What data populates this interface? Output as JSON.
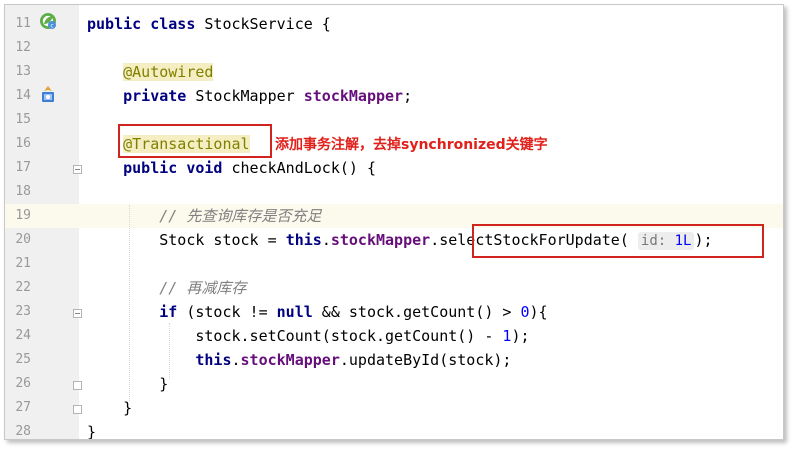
{
  "editor": {
    "lines": [
      {
        "num": "11",
        "tokens": [
          {
            "t": "kw",
            "v": "public class"
          },
          {
            "t": "plain",
            "v": " StockService {"
          }
        ]
      },
      {
        "num": "12",
        "tokens": []
      },
      {
        "num": "13",
        "tokens": [
          {
            "t": "plain",
            "v": "    "
          },
          {
            "t": "ann",
            "v": "@Autowired"
          }
        ]
      },
      {
        "num": "14",
        "tokens": [
          {
            "t": "plain",
            "v": "    "
          },
          {
            "t": "kw",
            "v": "private"
          },
          {
            "t": "plain",
            "v": " StockMapper "
          },
          {
            "t": "fld",
            "v": "stockMapper"
          },
          {
            "t": "plain",
            "v": ";"
          }
        ]
      },
      {
        "num": "15",
        "tokens": []
      },
      {
        "num": "16",
        "tokens": [
          {
            "t": "plain",
            "v": "    "
          },
          {
            "t": "ann",
            "v": "@Transactional"
          }
        ]
      },
      {
        "num": "17",
        "tokens": [
          {
            "t": "plain",
            "v": "    "
          },
          {
            "t": "kw",
            "v": "public void"
          },
          {
            "t": "plain",
            "v": " checkAndLock() {"
          }
        ]
      },
      {
        "num": "18",
        "tokens": []
      },
      {
        "num": "19",
        "tokens": [
          {
            "t": "plain",
            "v": "        "
          },
          {
            "t": "cmt",
            "v": "// 先查询库存是否充足"
          }
        ]
      },
      {
        "num": "20",
        "tokens": [
          {
            "t": "plain",
            "v": "        Stock stock = "
          },
          {
            "t": "kw",
            "v": "this"
          },
          {
            "t": "plain",
            "v": "."
          },
          {
            "t": "fld",
            "v": "stockMapper"
          },
          {
            "t": "plain",
            "v": ".selectStockForUpdate( "
          },
          {
            "t": "hint",
            "v": "id: "
          },
          {
            "t": "hintnum",
            "v": "1L"
          },
          {
            "t": "plain",
            "v": ");"
          }
        ]
      },
      {
        "num": "21",
        "tokens": []
      },
      {
        "num": "22",
        "tokens": [
          {
            "t": "plain",
            "v": "        "
          },
          {
            "t": "cmt",
            "v": "// 再减库存"
          }
        ]
      },
      {
        "num": "23",
        "tokens": [
          {
            "t": "plain",
            "v": "        "
          },
          {
            "t": "kw",
            "v": "if"
          },
          {
            "t": "plain",
            "v": " (stock != "
          },
          {
            "t": "kw",
            "v": "null"
          },
          {
            "t": "plain",
            "v": " && stock.getCount() > "
          },
          {
            "t": "num",
            "v": "0"
          },
          {
            "t": "plain",
            "v": "){"
          }
        ]
      },
      {
        "num": "24",
        "tokens": [
          {
            "t": "plain",
            "v": "            stock.setCount(stock.getCount() - "
          },
          {
            "t": "num",
            "v": "1"
          },
          {
            "t": "plain",
            "v": ");"
          }
        ]
      },
      {
        "num": "25",
        "tokens": [
          {
            "t": "plain",
            "v": "            "
          },
          {
            "t": "kw",
            "v": "this"
          },
          {
            "t": "plain",
            "v": "."
          },
          {
            "t": "fld",
            "v": "stockMapper"
          },
          {
            "t": "plain",
            "v": ".updateById(stock);"
          }
        ]
      },
      {
        "num": "26",
        "tokens": [
          {
            "t": "plain",
            "v": "        }"
          }
        ]
      },
      {
        "num": "27",
        "tokens": [
          {
            "t": "plain",
            "v": "    }"
          }
        ]
      },
      {
        "num": "28",
        "tokens": [
          {
            "t": "plain",
            "v": "}"
          }
        ]
      }
    ],
    "highlighted_line": "19"
  },
  "annotation_note": "添加事务注解，去掉synchronized关键字",
  "gutter_icons": {
    "class_icon": "spring-bean-class-icon",
    "autowired_icon": "autowired-injection-icon"
  },
  "colors": {
    "keyword": "#000080",
    "annotation": "#808000",
    "field": "#660e7a",
    "comment": "#808080",
    "number": "#0000ff",
    "callout_red": "#d0251f"
  }
}
